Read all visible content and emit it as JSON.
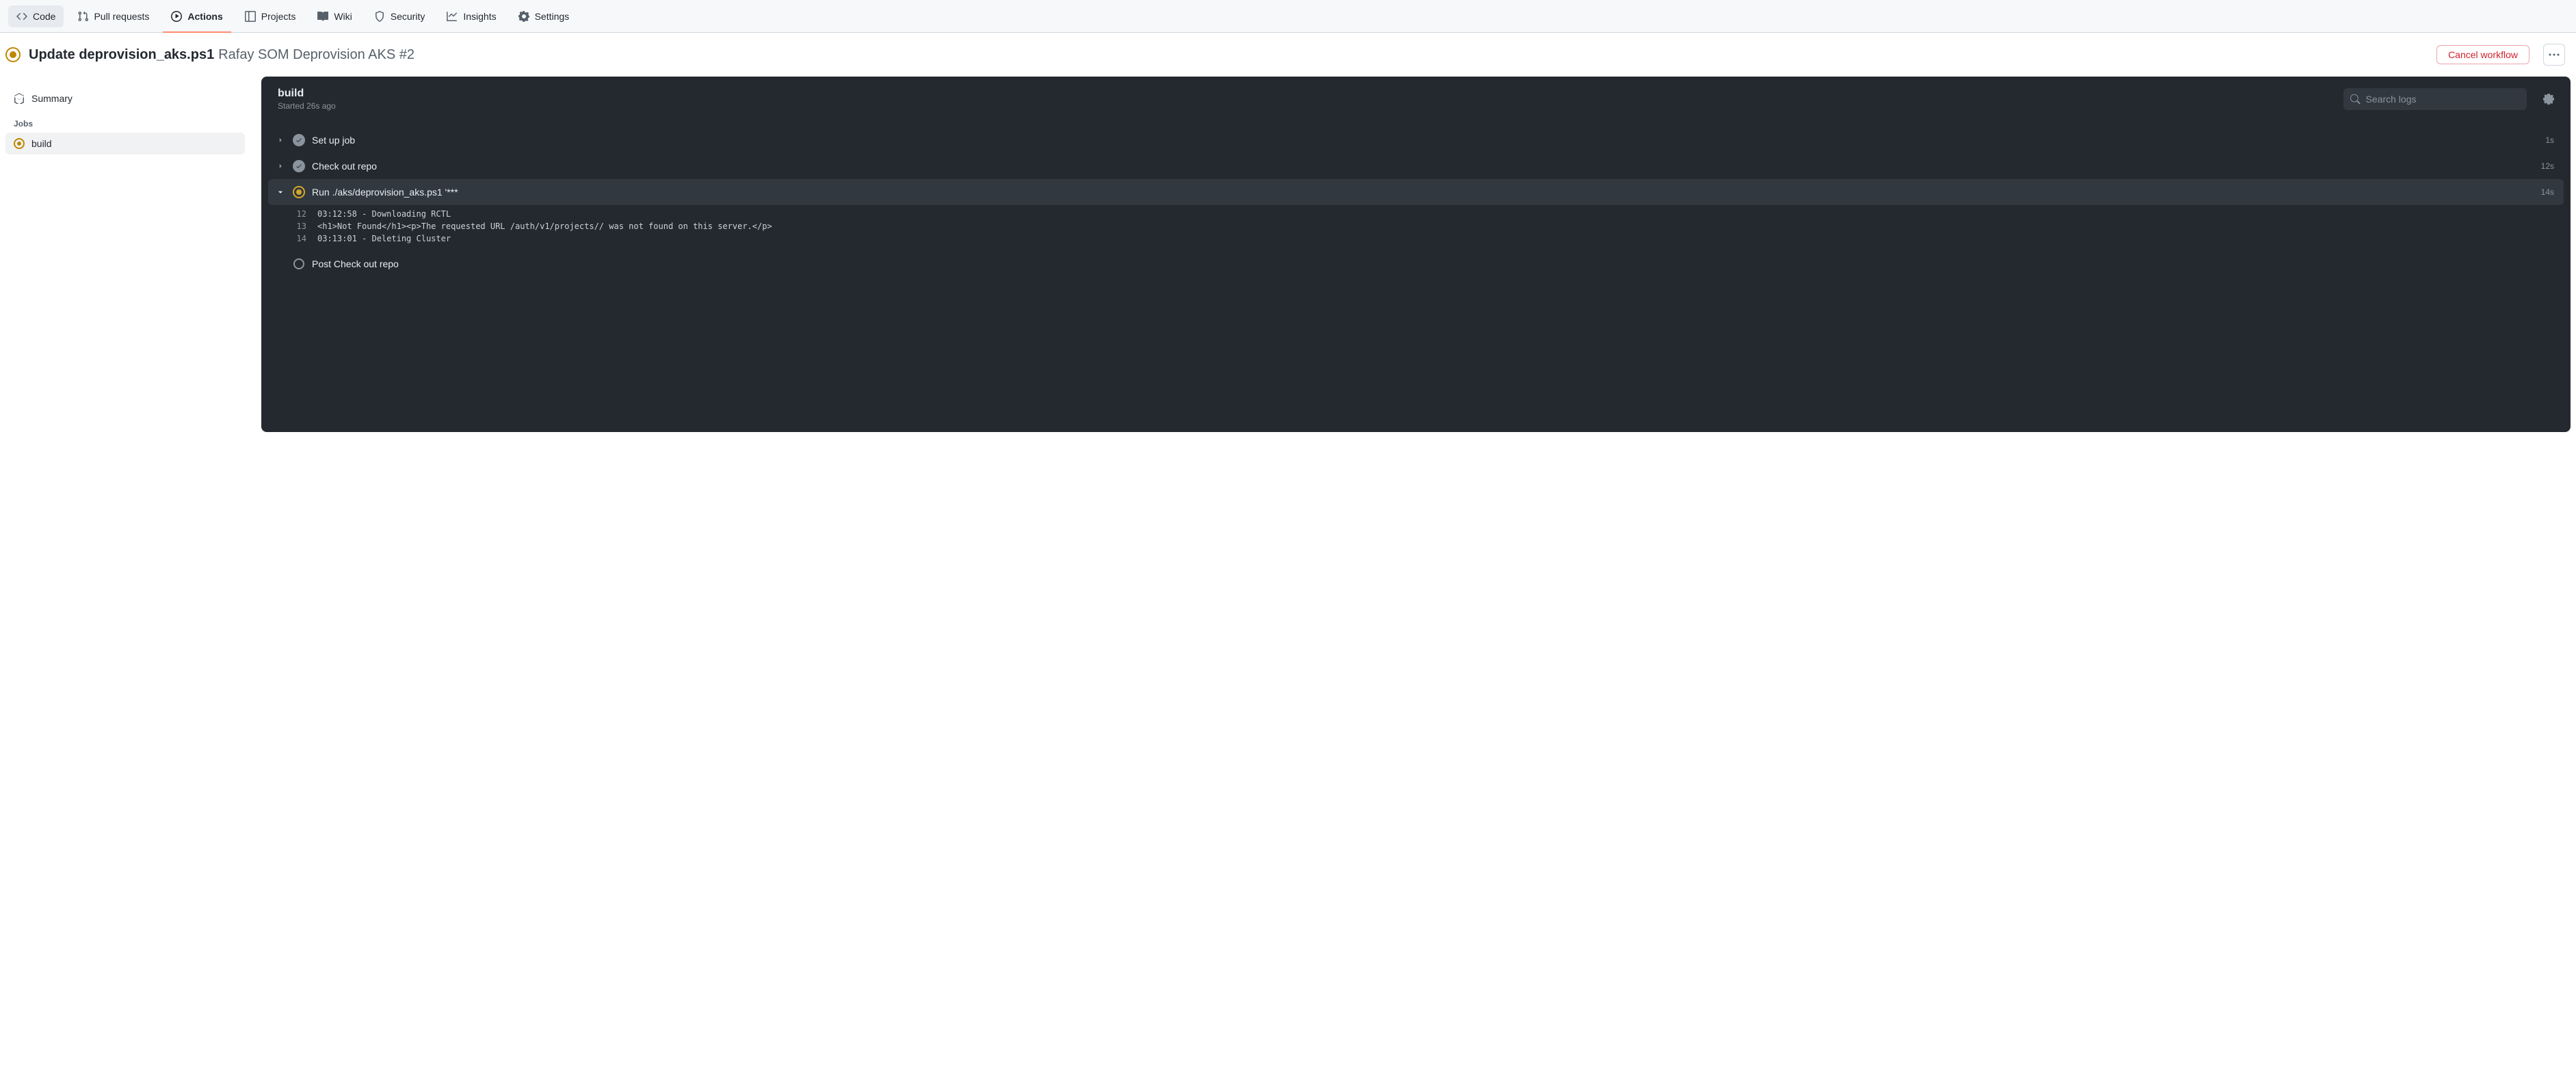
{
  "nav": {
    "code": "Code",
    "pulls": "Pull requests",
    "actions": "Actions",
    "projects": "Projects",
    "wiki": "Wiki",
    "security": "Security",
    "insights": "Insights",
    "settings": "Settings"
  },
  "header": {
    "title": "Update deprovision_aks.ps1",
    "subtitle": "Rafay SOM Deprovision AKS #2",
    "cancel": "Cancel workflow"
  },
  "sidebar": {
    "summary": "Summary",
    "jobs_header": "Jobs",
    "job_build": "build"
  },
  "panel": {
    "title": "build",
    "started": "Started 26s ago",
    "search_placeholder": "Search logs"
  },
  "steps": [
    {
      "name": "Set up job",
      "time": "1s",
      "status": "done",
      "expanded": false
    },
    {
      "name": "Check out repo",
      "time": "12s",
      "status": "done",
      "expanded": false
    },
    {
      "name": "Run ./aks/deprovision_aks.ps1 '***",
      "time": "14s",
      "status": "running",
      "expanded": true
    },
    {
      "name": "Post Check out repo",
      "time": "",
      "status": "pending",
      "expanded": false
    }
  ],
  "log": [
    {
      "n": "12",
      "t": "03:12:58 - Downloading RCTL"
    },
    {
      "n": "13",
      "t": "<h1>Not Found</h1><p>The requested URL /auth/v1/projects// was not found on this server.</p>"
    },
    {
      "n": "14",
      "t": "03:13:01 - Deleting Cluster"
    }
  ]
}
